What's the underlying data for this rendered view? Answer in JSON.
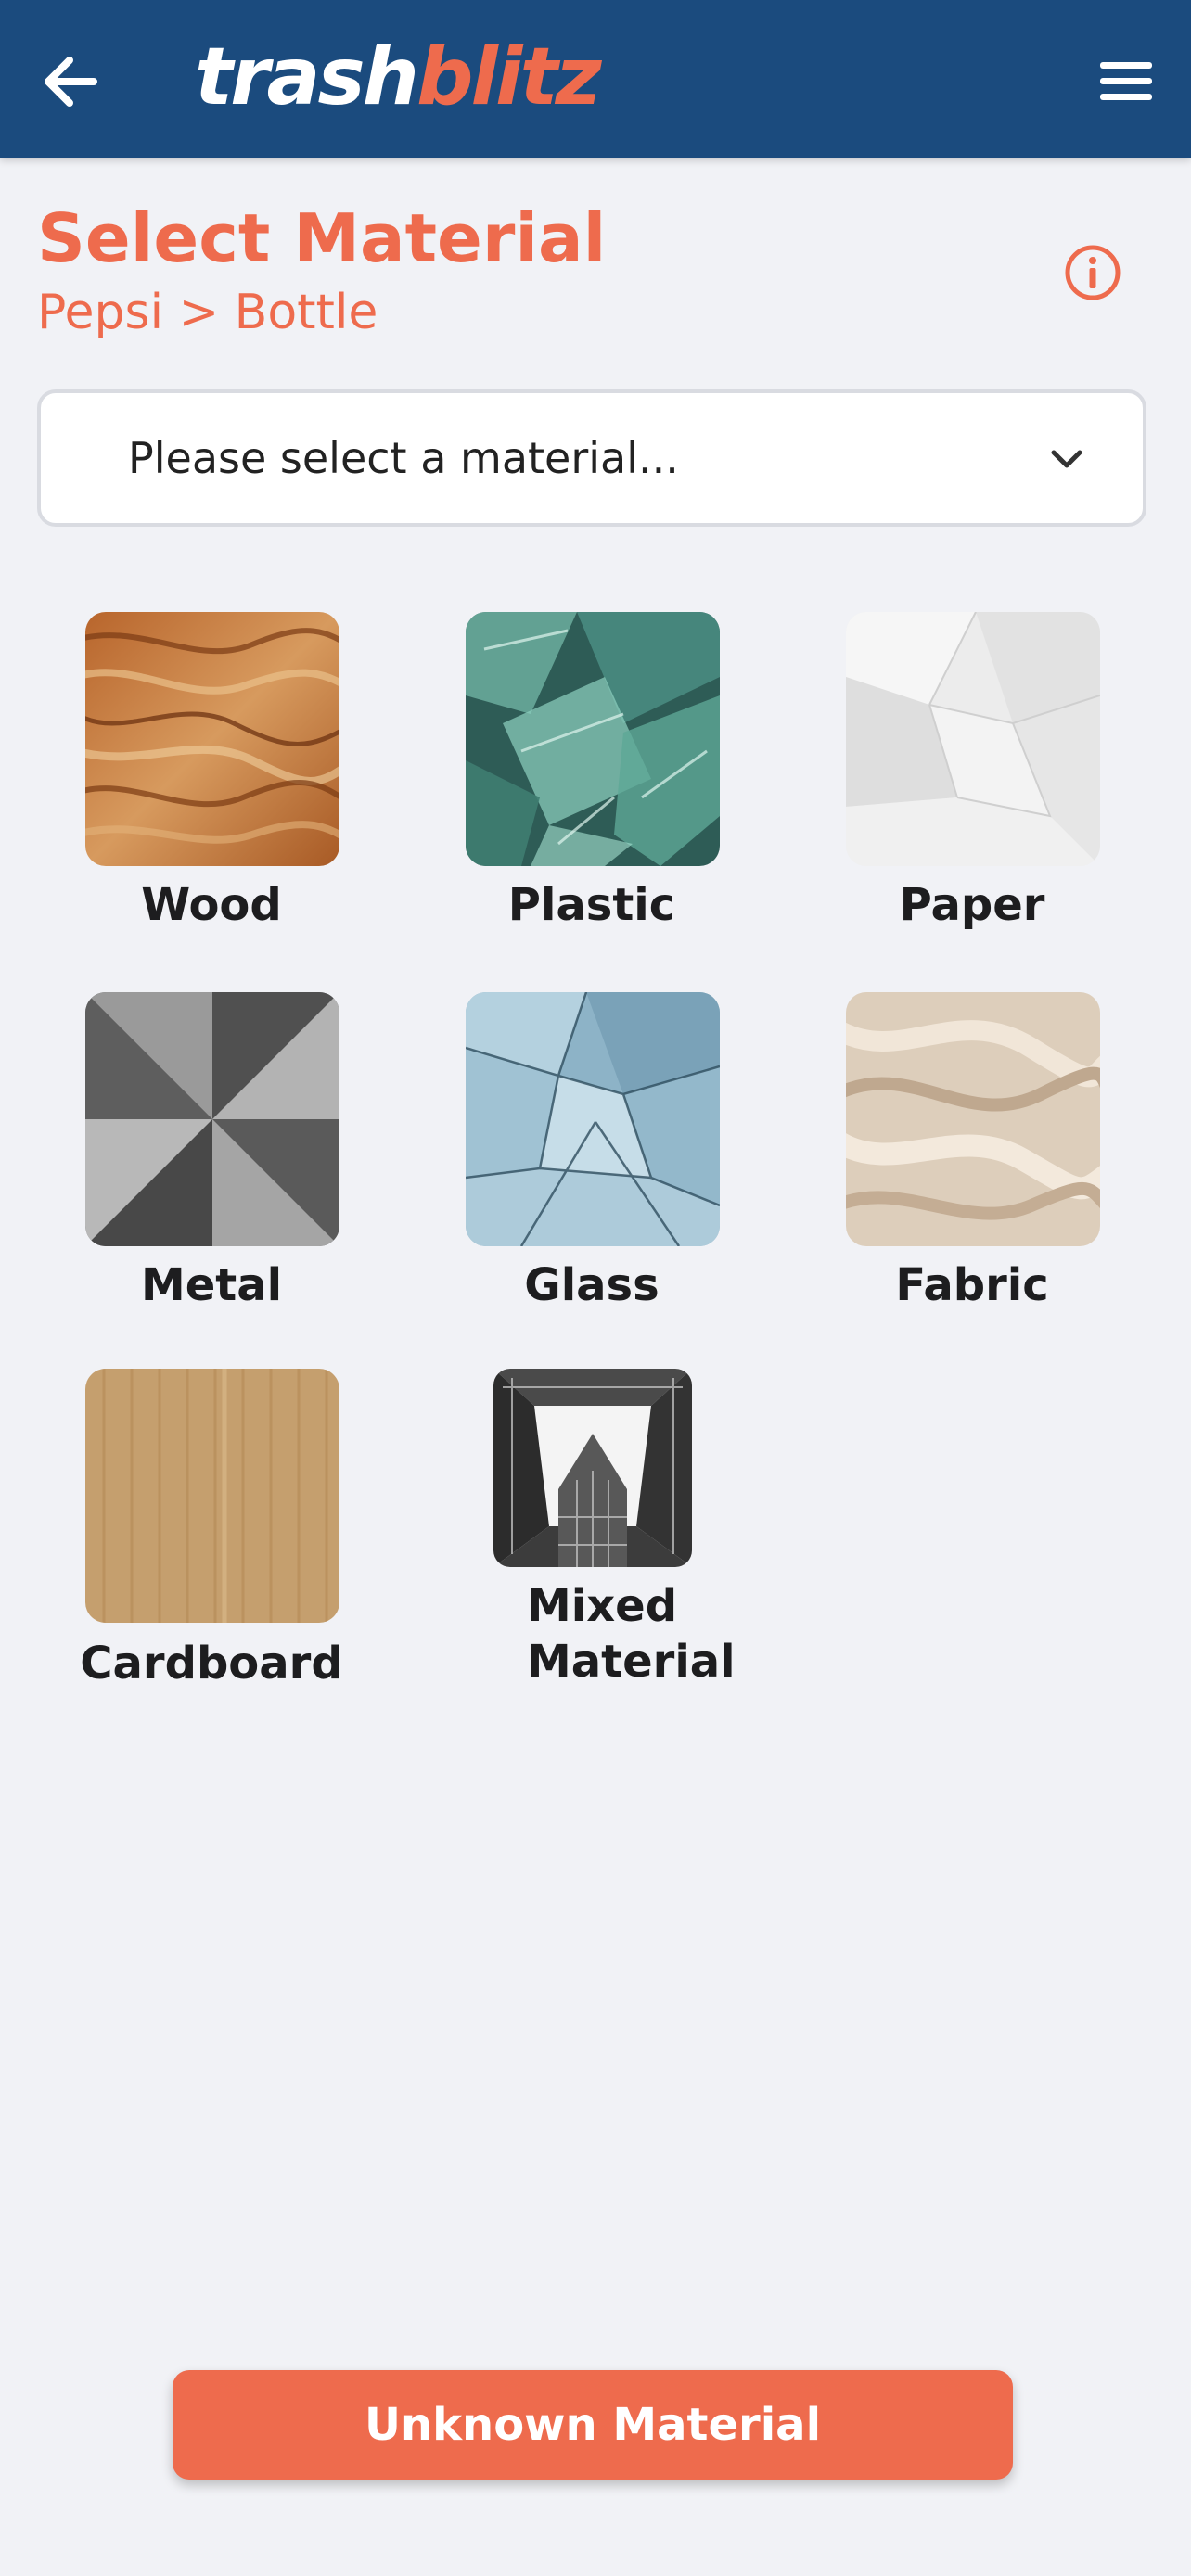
{
  "header": {
    "logo_part1": "trash",
    "logo_part2": "blitz"
  },
  "page": {
    "title": "Select Material",
    "breadcrumb": "Pepsi > Bottle"
  },
  "select": {
    "placeholder": "Please select a material..."
  },
  "materials": [
    {
      "label": "Wood"
    },
    {
      "label": "Plastic"
    },
    {
      "label": "Paper"
    },
    {
      "label": "Metal"
    },
    {
      "label": "Glass"
    },
    {
      "label": "Fabric"
    },
    {
      "label": "Cardboard"
    },
    {
      "label": "Mixed Material"
    }
  ],
  "footer": {
    "unknown_label": "Unknown Material"
  },
  "colors": {
    "header_bg": "#1b4b7e",
    "accent": "#ee6b4d",
    "page_bg": "#f1f2f6"
  }
}
